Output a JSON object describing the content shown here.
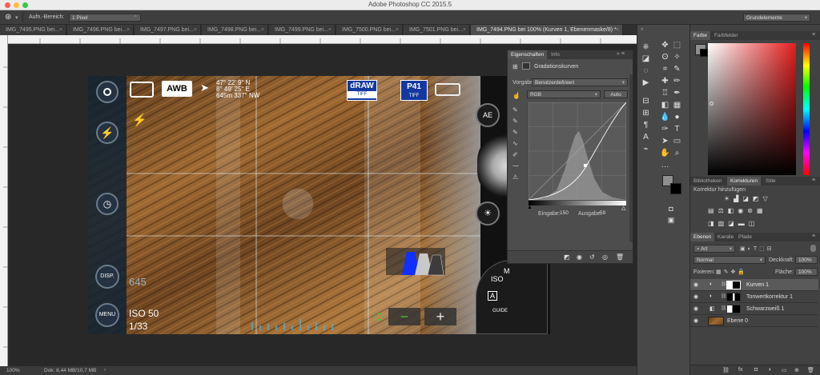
{
  "app": {
    "title": "Adobe Photoshop CC 2015.5",
    "workspace": "Grundelemente"
  },
  "options": {
    "sample_area_label": "Aufn.-Bereich:",
    "sample_area_value": "1 Pixel"
  },
  "tabs": [
    {
      "label": "IMG_7495.PNG bei..."
    },
    {
      "label": "IMG_7496.PNG bei..."
    },
    {
      "label": "IMG_7497.PNG bei..."
    },
    {
      "label": "IMG_7498.PNG bei..."
    },
    {
      "label": "IMG_7499.PNG bei..."
    },
    {
      "label": "IMG_7500.PNG bei..."
    },
    {
      "label": "IMG_7501.PNG bei..."
    },
    {
      "label": "IMG_7494.PNG bei 100% (Kurven 1, Ebenenmaske/8) *"
    }
  ],
  "status": {
    "zoom": "100%",
    "doc": "Dok: 8,44 MB/10,7 MB"
  },
  "camera": {
    "awb": "AWB",
    "gps_lat": "47° 22' 9\" N",
    "gps_lon": "8° 49' 25\" E",
    "gps_alt": "645m",
    "gps_dir": "337° NW",
    "draw_label": "dRAW",
    "draw_sub": "TIFF",
    "p41_label": "P41",
    "p41_sub": "TIFF",
    "disp": "DISP.",
    "menu": "MENU",
    "shots": "645",
    "iso": "ISO 50",
    "shutter": "1/33",
    "ae": "AE",
    "dial_iso": "ISO",
    "dial_m": "M",
    "dial_a": "A",
    "dial_guide": "GUIDE",
    "zero": "0",
    "minus": "−",
    "plus": "+"
  },
  "properties": {
    "tab_props": "Eigenschaften",
    "tab_info": "Info",
    "title": "Gradationskurven",
    "preset_label": "Vorgabe:",
    "preset_value": "Benutzerdefiniert",
    "channel": "RGB",
    "auto": "Auto",
    "input_label": "Eingabe:",
    "input_value": "150",
    "output_label": "Ausgabe:",
    "output_value": "59"
  },
  "color_panel": {
    "tab_color": "Farbe",
    "tab_swatches": "Farbfelder"
  },
  "adjust_panel": {
    "tab_lib": "Bibliotheken",
    "tab_adj": "Korrekturen",
    "tab_styles": "Stile",
    "add_label": "Korrektur hinzufügen"
  },
  "layers_panel": {
    "tab_layers": "Ebenen",
    "tab_channels": "Kanäle",
    "tab_paths": "Pfade",
    "filter": "Art",
    "blend": "Normal",
    "opacity_label": "Deckkraft:",
    "opacity_value": "100%",
    "lock_label": "Fixieren:",
    "fill_label": "Fläche:",
    "fill_value": "100%",
    "layers": [
      {
        "name": "Kurven 1"
      },
      {
        "name": "Tonwertkorrektur 1"
      },
      {
        "name": "Schwarzweiß 1"
      },
      {
        "name": "Ebene 0"
      }
    ]
  },
  "colors": {
    "accent_blue": "#1d6fd1",
    "hue_red": "#e51d1d"
  }
}
